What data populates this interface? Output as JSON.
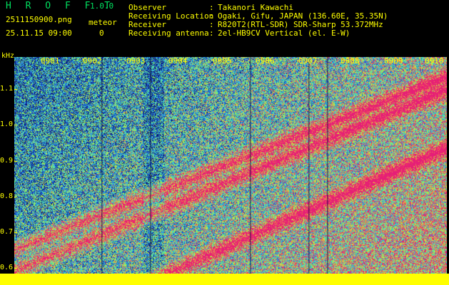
{
  "header": {
    "app_name": "H R O F F T",
    "app_version": "1.0.0",
    "filename": "2511150900.png",
    "counter_label": "meteor",
    "counter_value": "0",
    "datetime": "25.11.15 09:00"
  },
  "info": [
    {
      "label": "Observer",
      "value": "Takanori Kawachi"
    },
    {
      "label": "Receiving Location",
      "value": "Ogaki, Gifu, JAPAN (136.60E, 35.35N)"
    },
    {
      "label": "Receiver",
      "value": "R820T2(RTL-SDR) SDR-Sharp 53.372MHz"
    },
    {
      "label": "Receiving antenna",
      "value": "2el-HB9CV Vertical (el. E-W)"
    }
  ],
  "axis": {
    "y_unit": "kHz",
    "y_ticks": [
      "1.1",
      "1.0",
      "0.9",
      "0.8",
      "0.7",
      "0.6"
    ],
    "x_ticks": [
      "0901",
      "0902",
      "0903",
      "0904",
      "0905",
      "0906",
      "0907",
      "0908",
      "0909",
      "0910"
    ]
  },
  "colors": {
    "text": "#ffff00",
    "title": "#00e060",
    "background": "#000000"
  }
}
